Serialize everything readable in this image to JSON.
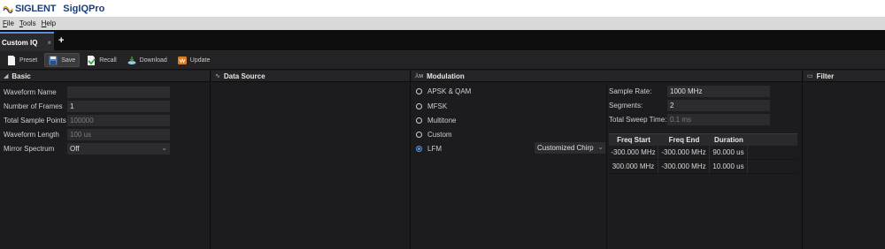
{
  "app": {
    "brand": "SIGLENT",
    "name": "SigIQPro"
  },
  "menu": [
    {
      "label": "File",
      "mnemonic": "F"
    },
    {
      "label": "Tools",
      "mnemonic": "T"
    },
    {
      "label": "Help",
      "mnemonic": "H"
    }
  ],
  "tabs": {
    "active_label": "Custom IQ",
    "close": "×",
    "add": "+"
  },
  "toolbar": {
    "preset": "Preset",
    "save": "Save",
    "recall": "Recall",
    "download": "Download",
    "update": "Update"
  },
  "basic": {
    "title": "Basic",
    "waveform_name": {
      "label": "Waveform Name",
      "value": ""
    },
    "number_of_frames": {
      "label": "Number of Frames",
      "value": "1"
    },
    "total_sample_points": {
      "label": "Total Sample Points",
      "value": "100000"
    },
    "waveform_length": {
      "label": "Waveform Length",
      "value": "100 us"
    },
    "mirror_spectrum": {
      "label": "Mirror Spectrum",
      "value": "Off"
    }
  },
  "data_source": {
    "title": "Data Source"
  },
  "modulation": {
    "title": "Modulation",
    "options": [
      {
        "label": "APSK & QAM",
        "checked": false
      },
      {
        "label": "MFSK",
        "checked": false
      },
      {
        "label": "Multitone",
        "checked": false
      },
      {
        "label": "Custom",
        "checked": false
      },
      {
        "label": "LFM",
        "checked": true
      }
    ],
    "lfm_mode": "Customized Chirp",
    "sample_rate": {
      "label": "Sample Rate:",
      "value": "1000 MHz"
    },
    "segments": {
      "label": "Segments:",
      "value": "2"
    },
    "total_sweep_time": {
      "label": "Total Sweep Time:",
      "value": "0.1 ms"
    },
    "table": {
      "headers": [
        "Freq Start",
        "Freq End",
        "Duration"
      ],
      "rows": [
        [
          "-300.000 MHz",
          "-300.000 MHz",
          "90.000 us"
        ],
        [
          "300.000 MHz",
          "-300.000 MHz",
          "10.000 us"
        ]
      ]
    }
  },
  "filter": {
    "title": "Filter"
  }
}
